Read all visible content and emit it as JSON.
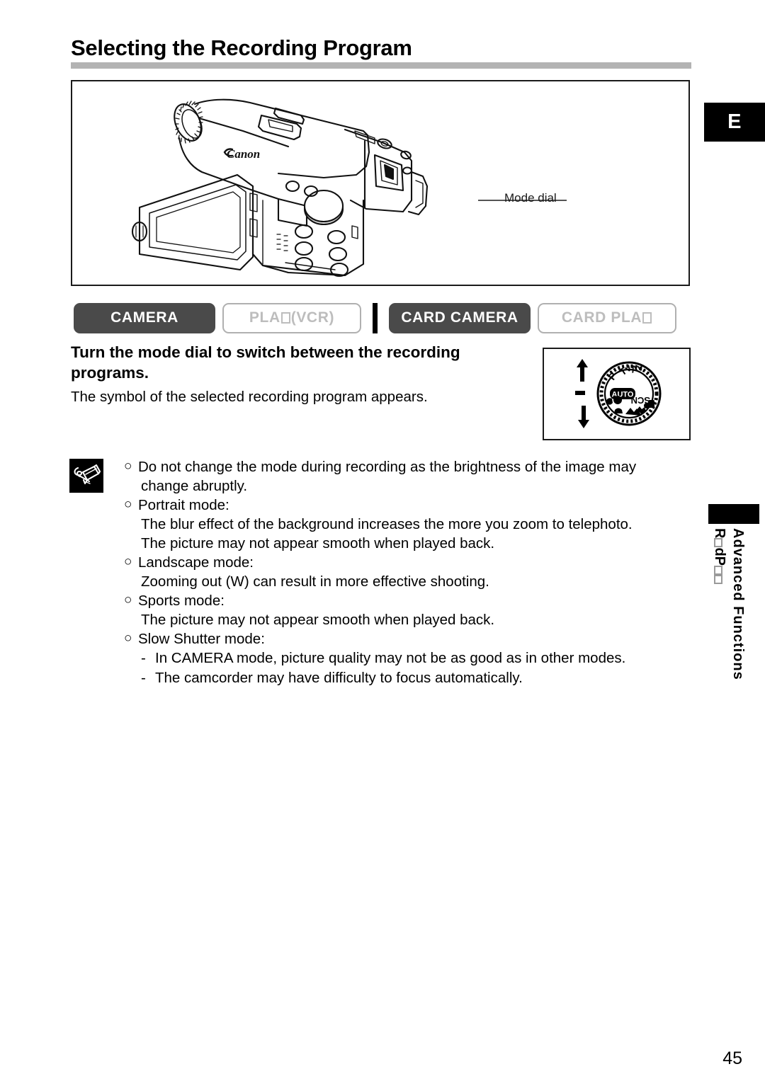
{
  "page": {
    "title": "Selecting the Recording Program",
    "language_badge": "E",
    "page_number": "45"
  },
  "illustration": {
    "callout_label": "Mode dial",
    "brand_text": "Canon",
    "icon_name": "camcorder-line-art"
  },
  "mode_tabs": [
    {
      "id": "camera",
      "label": "CAMERA",
      "state": "active"
    },
    {
      "id": "play-vcr",
      "label_pre": "PLA",
      "label_post": " (VCR)",
      "has_tofu": true,
      "state": "inactive"
    },
    {
      "id": "card-camera",
      "label": "CARD CAMERA",
      "state": "active"
    },
    {
      "id": "card-play",
      "label_pre": "CARD PLA",
      "label_post": "",
      "has_tofu": true,
      "state": "inactive"
    }
  ],
  "instruction": {
    "heading": "Turn the mode dial to switch between the recording programs.",
    "body": "The symbol of the selected recording program appears."
  },
  "dial_figure": {
    "icon_name": "mode-dial-diagram",
    "labels": [
      "AUTO",
      "P",
      "Tv",
      "Av",
      "SCN"
    ],
    "arrow_up": "rotate-up-arrow",
    "arrow_down": "rotate-down-arrow"
  },
  "notes": {
    "icon_name": "memo-pencil-icon",
    "bullet_glyph": "❑",
    "items": [
      {
        "bullet": "○",
        "lines": [
          "Do not change the mode during recording as the brightness of the image may",
          "change abruptly."
        ]
      },
      {
        "bullet": "○",
        "lines": [
          "Portrait mode:"
        ],
        "cont": [
          "The blur effect of the background increases the more you zoom to telephoto.",
          "The picture may not appear smooth when played back."
        ]
      },
      {
        "bullet": "○",
        "lines": [
          "Landscape mode:"
        ],
        "cont": [
          "Zooming out (W) can result in more effective shooting."
        ]
      },
      {
        "bullet": "○",
        "lines": [
          "Sports mode:"
        ],
        "cont": [
          "The picture may not appear smooth when played back."
        ]
      },
      {
        "bullet": "○",
        "lines": [
          "Slow Shutter mode:"
        ],
        "sub": [
          "In CAMERA mode, picture quality may not be as good as in other modes.",
          "The camcorder may have difficulty to focus automatically."
        ],
        "sub_dash": "-"
      }
    ]
  },
  "side_tab": {
    "main_label": "Advanced Functions",
    "sub_pre": "R",
    "sub_mid": "dP",
    "sub_post": ""
  },
  "colors": {
    "title_rule": "#b3b3b3",
    "tab_active_bg": "#4a4a4a",
    "tab_inactive_border": "#b0b0b0",
    "tab_inactive_text": "#bdbdbd",
    "badge_bg": "#000000",
    "frame_border": "#1a1a1a"
  }
}
